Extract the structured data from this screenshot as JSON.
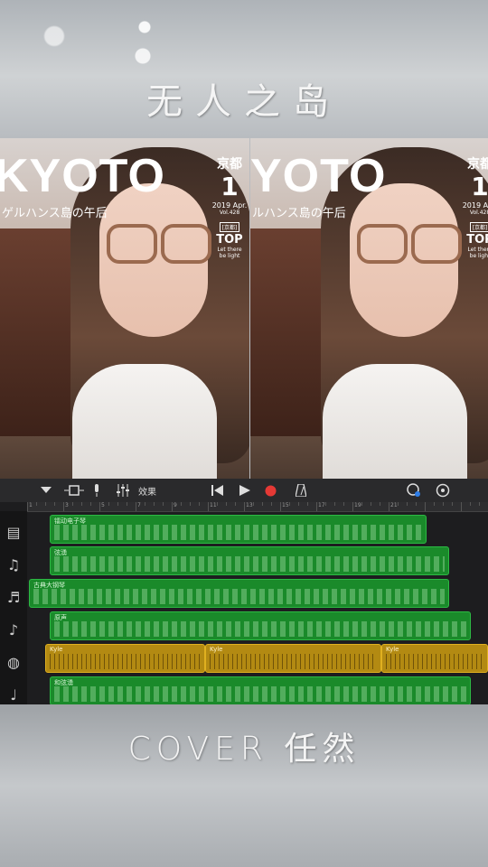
{
  "title": "无人之岛",
  "cover": "COVER 任然",
  "magazine": {
    "left_title": "KYOTO",
    "right_title": "YOTO",
    "subtitle_left": "ゲルハンス島の午后",
    "subtitle_right": "ルハンス島の午后",
    "city": "京都",
    "number": "1",
    "date": "2019 Apr.",
    "vol": "Vol.428",
    "tag": "[京都]",
    "top_label": "TOP",
    "small_text_1": "Let there",
    "small_text_2": "be light"
  },
  "toolbar": {
    "effects_label": "效果"
  },
  "tracks": [
    {
      "icon": "keyboard-icon",
      "label": "镭动电子琴"
    },
    {
      "icon": "violin-icon",
      "label": "弦湧"
    },
    {
      "icon": "piano-icon",
      "label": "古典大钢琴"
    },
    {
      "icon": "guitar-icon",
      "label": "原声"
    },
    {
      "icon": "drums-icon",
      "label": "Kyle"
    },
    {
      "icon": "electric-guitar-icon",
      "label": "和弦湧"
    }
  ],
  "ruler_numbers": [
    "1",
    "3",
    "5",
    "7",
    "9",
    "11",
    "13",
    "15",
    "17",
    "19",
    "21"
  ],
  "colors": {
    "midi_region": "#1a8a2a",
    "drum_region": "#b38a12",
    "record": "#e53935"
  }
}
